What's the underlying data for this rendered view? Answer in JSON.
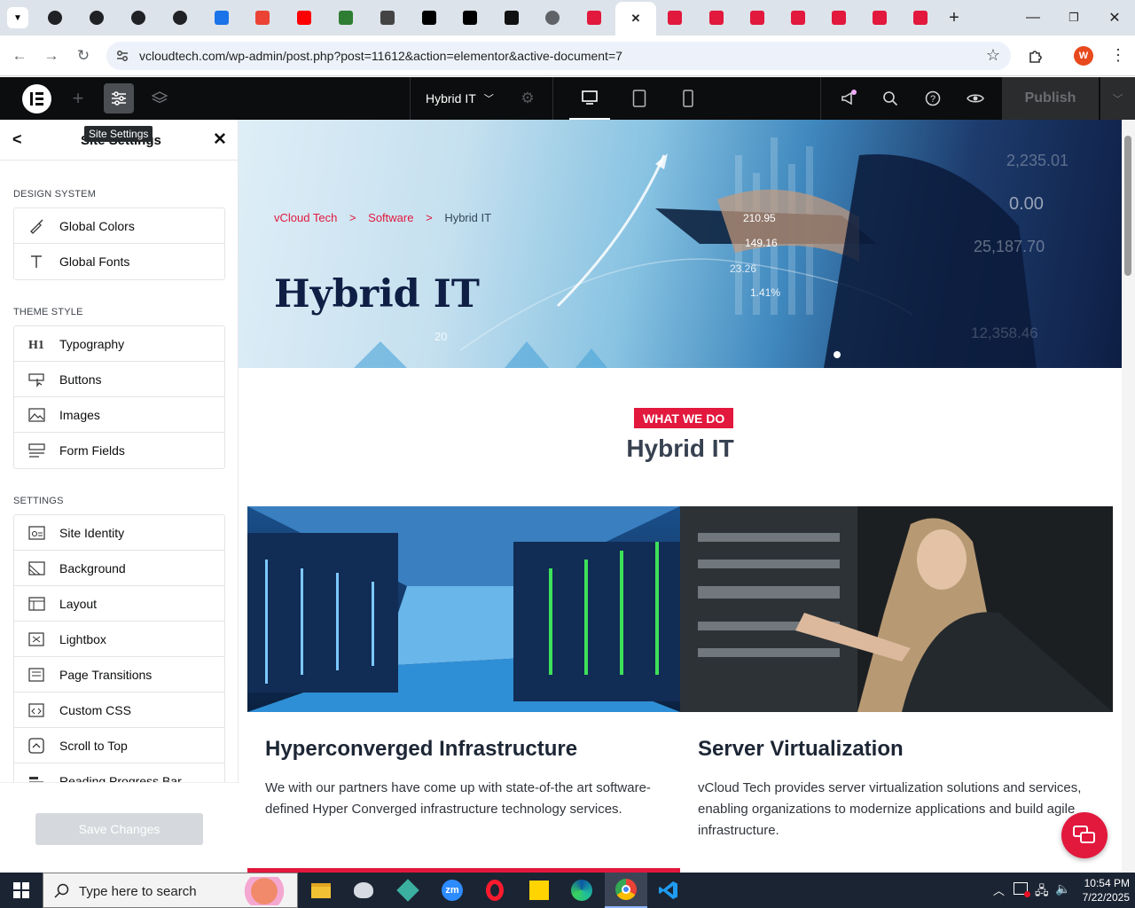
{
  "browser": {
    "url": "vcloudtech.com/wp-admin/post.php?post=11612&action=elementor&active-document=7",
    "profile_initial": "W",
    "tabs": [
      {
        "icon": "openai-icon",
        "color": "#202124"
      },
      {
        "icon": "openai-icon",
        "color": "#202124"
      },
      {
        "icon": "openai-icon",
        "color": "#202124"
      },
      {
        "icon": "openai-icon",
        "color": "#202124"
      },
      {
        "icon": "copilot-icon",
        "color": "#1a73e8"
      },
      {
        "icon": "google-icon",
        "color": "#ea4335"
      },
      {
        "icon": "youtube-icon",
        "color": "#ff0000"
      },
      {
        "icon": "w-app-icon",
        "color": "#2e7d32"
      },
      {
        "icon": "linkedin-icon",
        "color": "#444"
      },
      {
        "icon": "x-icon",
        "color": "#000"
      },
      {
        "icon": "x-icon",
        "color": "#000"
      },
      {
        "icon": "perplexity-icon",
        "color": "#111"
      },
      {
        "icon": "globe-icon",
        "color": "#5f6368"
      },
      {
        "icon": "elementor-site-icon",
        "color": "#e2183d"
      },
      {
        "icon": "close-icon",
        "color": "#222"
      },
      {
        "icon": "elementor-site-icon",
        "color": "#e2183d"
      },
      {
        "icon": "elementor-site-icon",
        "color": "#e2183d"
      },
      {
        "icon": "elementor-site-icon",
        "color": "#e2183d"
      },
      {
        "icon": "elementor-site-icon",
        "color": "#e2183d"
      },
      {
        "icon": "elementor-site-icon",
        "color": "#e2183d"
      },
      {
        "icon": "elementor-site-icon",
        "color": "#e2183d"
      },
      {
        "icon": "elementor-site-icon",
        "color": "#e2183d"
      }
    ]
  },
  "editor": {
    "document_title": "Hybrid IT",
    "publish_label": "Publish"
  },
  "panel": {
    "title": "Site Settings",
    "tooltip": "Site Settings",
    "sections": [
      {
        "label": "DESIGN SYSTEM",
        "items": [
          "Global Colors",
          "Global Fonts"
        ]
      },
      {
        "label": "THEME STYLE",
        "items": [
          "Typography",
          "Buttons",
          "Images",
          "Form Fields"
        ]
      },
      {
        "label": "SETTINGS",
        "items": [
          "Site Identity",
          "Background",
          "Layout",
          "Lightbox",
          "Page Transitions",
          "Custom CSS",
          "Scroll to Top",
          "Reading Progress Bar"
        ]
      }
    ],
    "save_label": "Save Changes"
  },
  "page": {
    "breadcrumb": [
      "vCloud Tech",
      "Software",
      "Hybrid IT"
    ],
    "breadcrumb_sep": ">",
    "hero_title": "Hybrid IT",
    "hero_numbers": [
      "210.95",
      "149.16",
      "23.26",
      "1.41%",
      "0.00",
      "25,187.70",
      "12,358.46",
      "2,235.01",
      "20"
    ],
    "eyebrow": "WHAT WE DO",
    "section_title": "Hybrid IT",
    "cards": [
      {
        "title": "Hyperconverged Infrastructure",
        "text": "We with our partners have come up with state-of-the art software-defined Hyper Converged infrastructure technology services."
      },
      {
        "title": "Server Virtualization",
        "text": "vCloud Tech provides server virtualization solutions and services, enabling organizations to modernize applications and build agile infrastructure."
      }
    ],
    "accent": "#e2183d"
  },
  "taskbar": {
    "search_placeholder": "Type here to search",
    "time": "10:54 PM",
    "date": "7/22/2025"
  }
}
